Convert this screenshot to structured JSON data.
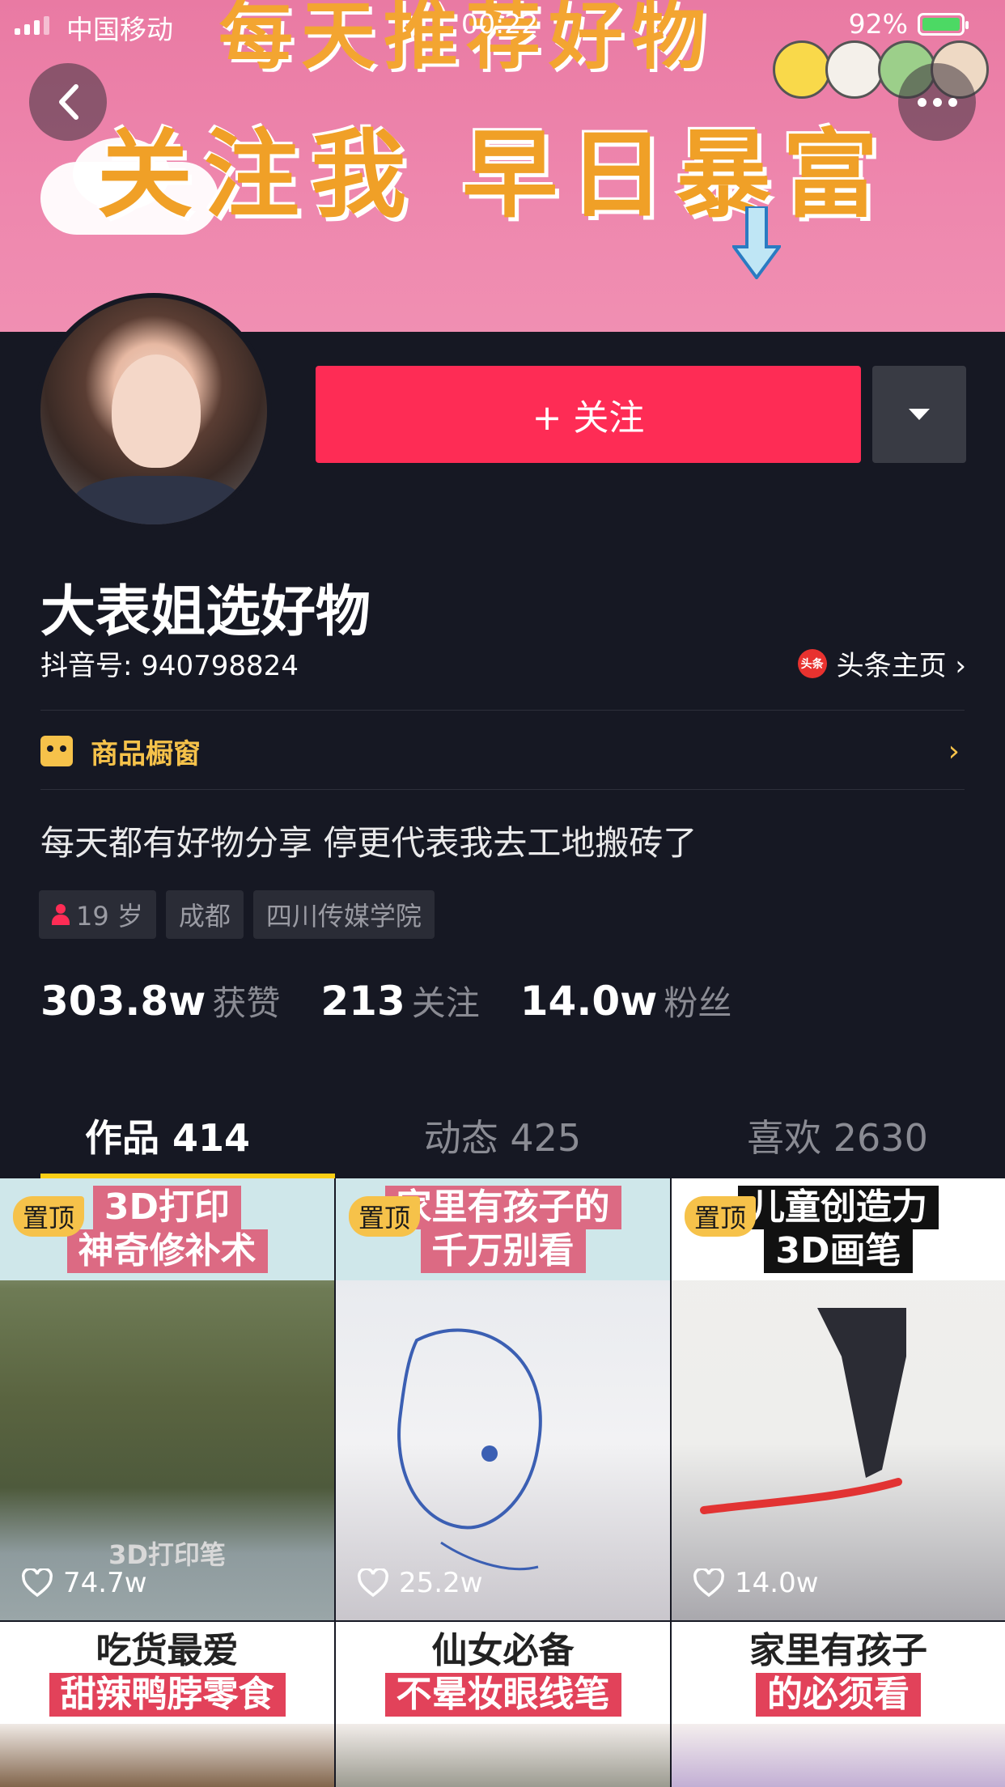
{
  "status_bar": {
    "carrier": "中国移动",
    "time": "00:22",
    "battery": "92%"
  },
  "banner": {
    "top_text": "每天推荐好物",
    "main_text": "关注我 早日暴富"
  },
  "profile": {
    "follow_label": "+ 关注",
    "name": "大表姐选好物",
    "douyin_id": "抖音号: 940798824",
    "toutiao_badge": "头条",
    "toutiao_label": "头条主页 ›",
    "shop_label": "商品橱窗",
    "bio": "每天都有好物分享  停更代表我去工地搬砖了",
    "tags": [
      "19 岁",
      "成都",
      "四川传媒学院"
    ]
  },
  "stats": [
    {
      "value": "303.8w",
      "label": "获赞"
    },
    {
      "value": "213",
      "label": "关注"
    },
    {
      "value": "14.0w",
      "label": "粉丝"
    }
  ],
  "tabs": [
    {
      "label": "作品 414",
      "active": true
    },
    {
      "label": "动态 425",
      "active": false
    },
    {
      "label": "喜欢 2630",
      "active": false
    }
  ],
  "videos": [
    {
      "pin": "置顶",
      "line1": "3D打印",
      "line2": "神奇修补术",
      "caption": "3D打印笔",
      "likes": "74.7w"
    },
    {
      "pin": "置顶",
      "line1": "家里有孩子的",
      "line2": "千万别看",
      "likes": "25.2w"
    },
    {
      "pin": "置顶",
      "line1": "儿童创造力",
      "line2": "3D画笔",
      "likes": "14.0w"
    },
    {
      "line1": "吃货最爱",
      "line2": "甜辣鸭脖零食"
    },
    {
      "line1": "仙女必备",
      "line2": "不晕妆眼线笔"
    },
    {
      "line1": "家里有孩子",
      "line2": "的必须看"
    }
  ],
  "colors": {
    "background": "#161823",
    "accent_red": "#fe2c55",
    "accent_yellow": "#face15",
    "banner_pink": "#ee86ad"
  }
}
